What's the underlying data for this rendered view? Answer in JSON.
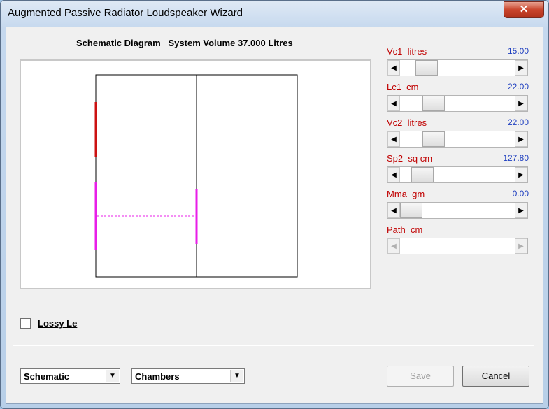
{
  "window": {
    "title": "Augmented Passive Radiator Loudspeaker Wizard",
    "close_glyph": "✕"
  },
  "diagram": {
    "caption": "Schematic Diagram   System Volume 37.000 Litres",
    "colors": {
      "driver": "#cc1111",
      "radiator": "#e81ee8",
      "outline": "#000000"
    }
  },
  "params": [
    {
      "label": "Vc1  litres",
      "value": "15.00",
      "slider_fraction": 0.17,
      "enabled": true
    },
    {
      "label": "Lc1  cm",
      "value": "22.00",
      "slider_fraction": 0.24,
      "enabled": true
    },
    {
      "label": "Vc2  litres",
      "value": "22.00",
      "slider_fraction": 0.24,
      "enabled": true
    },
    {
      "label": "Sp2  sq cm",
      "value": "127.80",
      "slider_fraction": 0.12,
      "enabled": true
    },
    {
      "label": "Mma  gm",
      "value": "0.00",
      "slider_fraction": 0.0,
      "enabled": true
    },
    {
      "label": "Path  cm",
      "value": "",
      "slider_fraction": 0.0,
      "enabled": false
    }
  ],
  "arrows": {
    "left": "◀",
    "right": "▶",
    "down": "▼"
  },
  "lossy_le": {
    "label": "Lossy Le",
    "checked": false
  },
  "view_select": {
    "value": "Schematic"
  },
  "layout_select": {
    "value": "Chambers"
  },
  "buttons": {
    "save": "Save",
    "cancel": "Cancel"
  }
}
